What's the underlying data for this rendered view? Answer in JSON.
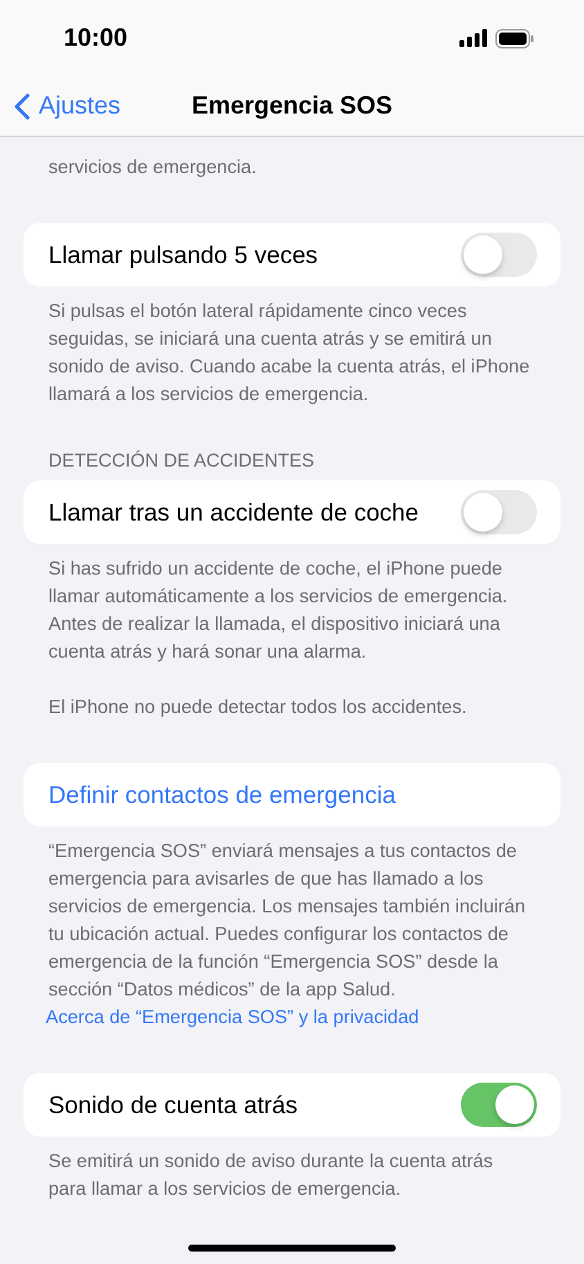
{
  "status_bar": {
    "time": "10:00"
  },
  "nav": {
    "back": "Ajustes",
    "title": "Emergencia SOS"
  },
  "sections": [
    {
      "footer": [
        {
          "kind": "text",
          "text": "servicios de emergencia."
        }
      ]
    },
    {
      "rows": [
        {
          "kind": "toggle",
          "label": "Llamar pulsando 5 veces",
          "on": false
        }
      ],
      "footer": [
        {
          "kind": "text",
          "text": "Si pulsas el botón lateral rápidamente cinco veces seguidas, se iniciará una cuenta atrás y se emitirá un sonido de aviso. Cuando acabe la cuenta atrás, el iPhone llamará a los servicios de emergencia."
        }
      ]
    },
    {
      "header": "DETECCIÓN DE ACCIDENTES",
      "rows": [
        {
          "kind": "toggle",
          "label": "Llamar tras un accidente de coche",
          "on": false
        }
      ],
      "footer": [
        {
          "kind": "text",
          "text": "Si has sufrido un accidente de coche, el iPhone puede llamar automáticamente a los servicios de emergencia. Antes de realizar la llamada, el dispositivo iniciará una cuenta atrás y hará sonar una alarma."
        },
        {
          "kind": "text",
          "text": "El iPhone no puede detectar todos los accidentes."
        }
      ]
    },
    {
      "rows": [
        {
          "kind": "link",
          "label": "Definir contactos de emergencia"
        }
      ],
      "footer": [
        {
          "kind": "text",
          "text": "“Emergencia SOS” enviará mensajes a tus contactos de emergencia para avisarles de que has llamado a los servicios de emergencia. Los mensajes también incluirán tu ubicación actual. Puedes configurar los contactos de emergencia de la función “Emergencia SOS” desde la sección “Datos médicos” de la app Salud."
        },
        {
          "kind": "link",
          "text": "Acerca de “Emergencia SOS” y la privacidad"
        }
      ]
    },
    {
      "rows": [
        {
          "kind": "toggle",
          "label": "Sonido de cuenta atrás",
          "on": true
        }
      ],
      "footer": [
        {
          "kind": "text",
          "text": "Se emitirá un sonido de aviso durante la cuenta atrás para llamar a los servicios de emergencia."
        }
      ]
    }
  ]
}
